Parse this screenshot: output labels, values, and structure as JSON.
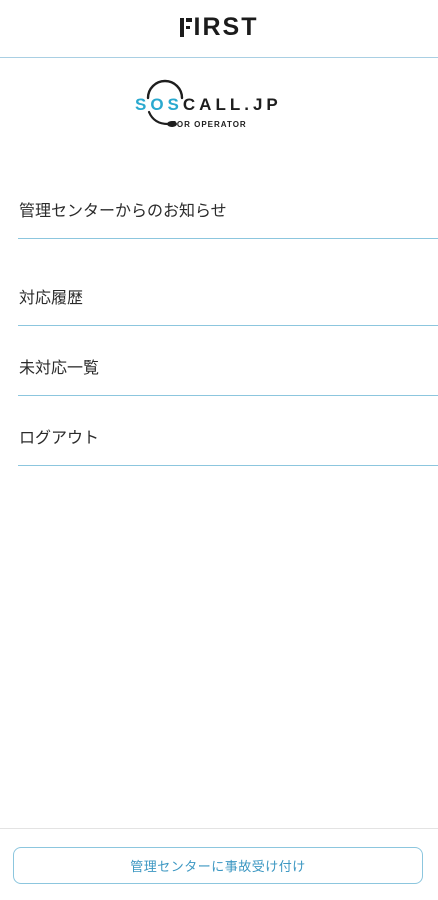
{
  "header": {
    "brand_rest": "IRST",
    "brand_full": "FIRST"
  },
  "logo": {
    "sos": "SOS",
    "call": "CALL.JP",
    "sub": "FOR OPERATOR",
    "accent_color": "#2aa9cf"
  },
  "menu": {
    "items": [
      {
        "label": "管理センターからのお知らせ"
      },
      {
        "label": "対応履歴"
      },
      {
        "label": "未対応一覧"
      },
      {
        "label": "ログアウト"
      }
    ],
    "divider_color": "#8cc6de"
  },
  "footer": {
    "button_label": "管理センターに事故受け付け",
    "button_color": "#3c97c2"
  }
}
